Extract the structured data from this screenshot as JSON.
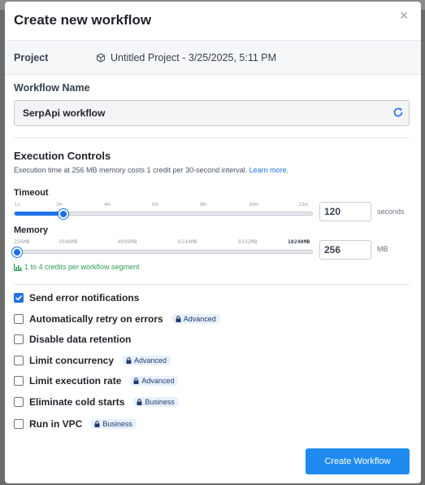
{
  "modal": {
    "title": "Create new workflow",
    "close_glyph": "×"
  },
  "project": {
    "label": "Project",
    "value": "Untitled Project - 3/25/2025, 5:11 PM",
    "icon": "cube-icon"
  },
  "workflow_name": {
    "label": "Workflow Name",
    "value": "SerpApi workflow",
    "icon": "refresh-icon"
  },
  "execution": {
    "title": "Execution Controls",
    "description": "Execution time at 256 MB memory costs 1 credit per 30-second interval.",
    "learn_more": "Learn more."
  },
  "timeout": {
    "label": "Timeout",
    "ticks": [
      "1s",
      "2m",
      "4m",
      "6m",
      "8m",
      "10m",
      "12m"
    ],
    "value": "120",
    "unit": "seconds",
    "slider_fraction": 0.165
  },
  "memory": {
    "label": "Memory",
    "ticks": [
      "256MB",
      "2048MB",
      "4096MB",
      "6144MB",
      "8192MB",
      "10240MB"
    ],
    "value": "256",
    "unit": "MB",
    "slider_fraction": 0.0
  },
  "credits": {
    "text": "1 to 4 credits per workflow segment",
    "icon": "bar-chart-icon"
  },
  "options": [
    {
      "label": "Send error notifications",
      "checked": true,
      "badge": ""
    },
    {
      "label": "Automatically retry on errors",
      "checked": false,
      "badge": "Advanced"
    },
    {
      "label": "Disable data retention",
      "checked": false,
      "badge": ""
    },
    {
      "label": "Limit concurrency",
      "checked": false,
      "badge": "Advanced"
    },
    {
      "label": "Limit execution rate",
      "checked": false,
      "badge": "Advanced"
    },
    {
      "label": "Eliminate cold starts",
      "checked": false,
      "badge": "Business"
    },
    {
      "label": "Run in VPC",
      "checked": false,
      "badge": "Business"
    }
  ],
  "actions": {
    "create_label": "Create Workflow"
  },
  "colors": {
    "accent": "#1d72e8",
    "button": "#1f8bf0",
    "credits_green": "#2e9d57"
  }
}
